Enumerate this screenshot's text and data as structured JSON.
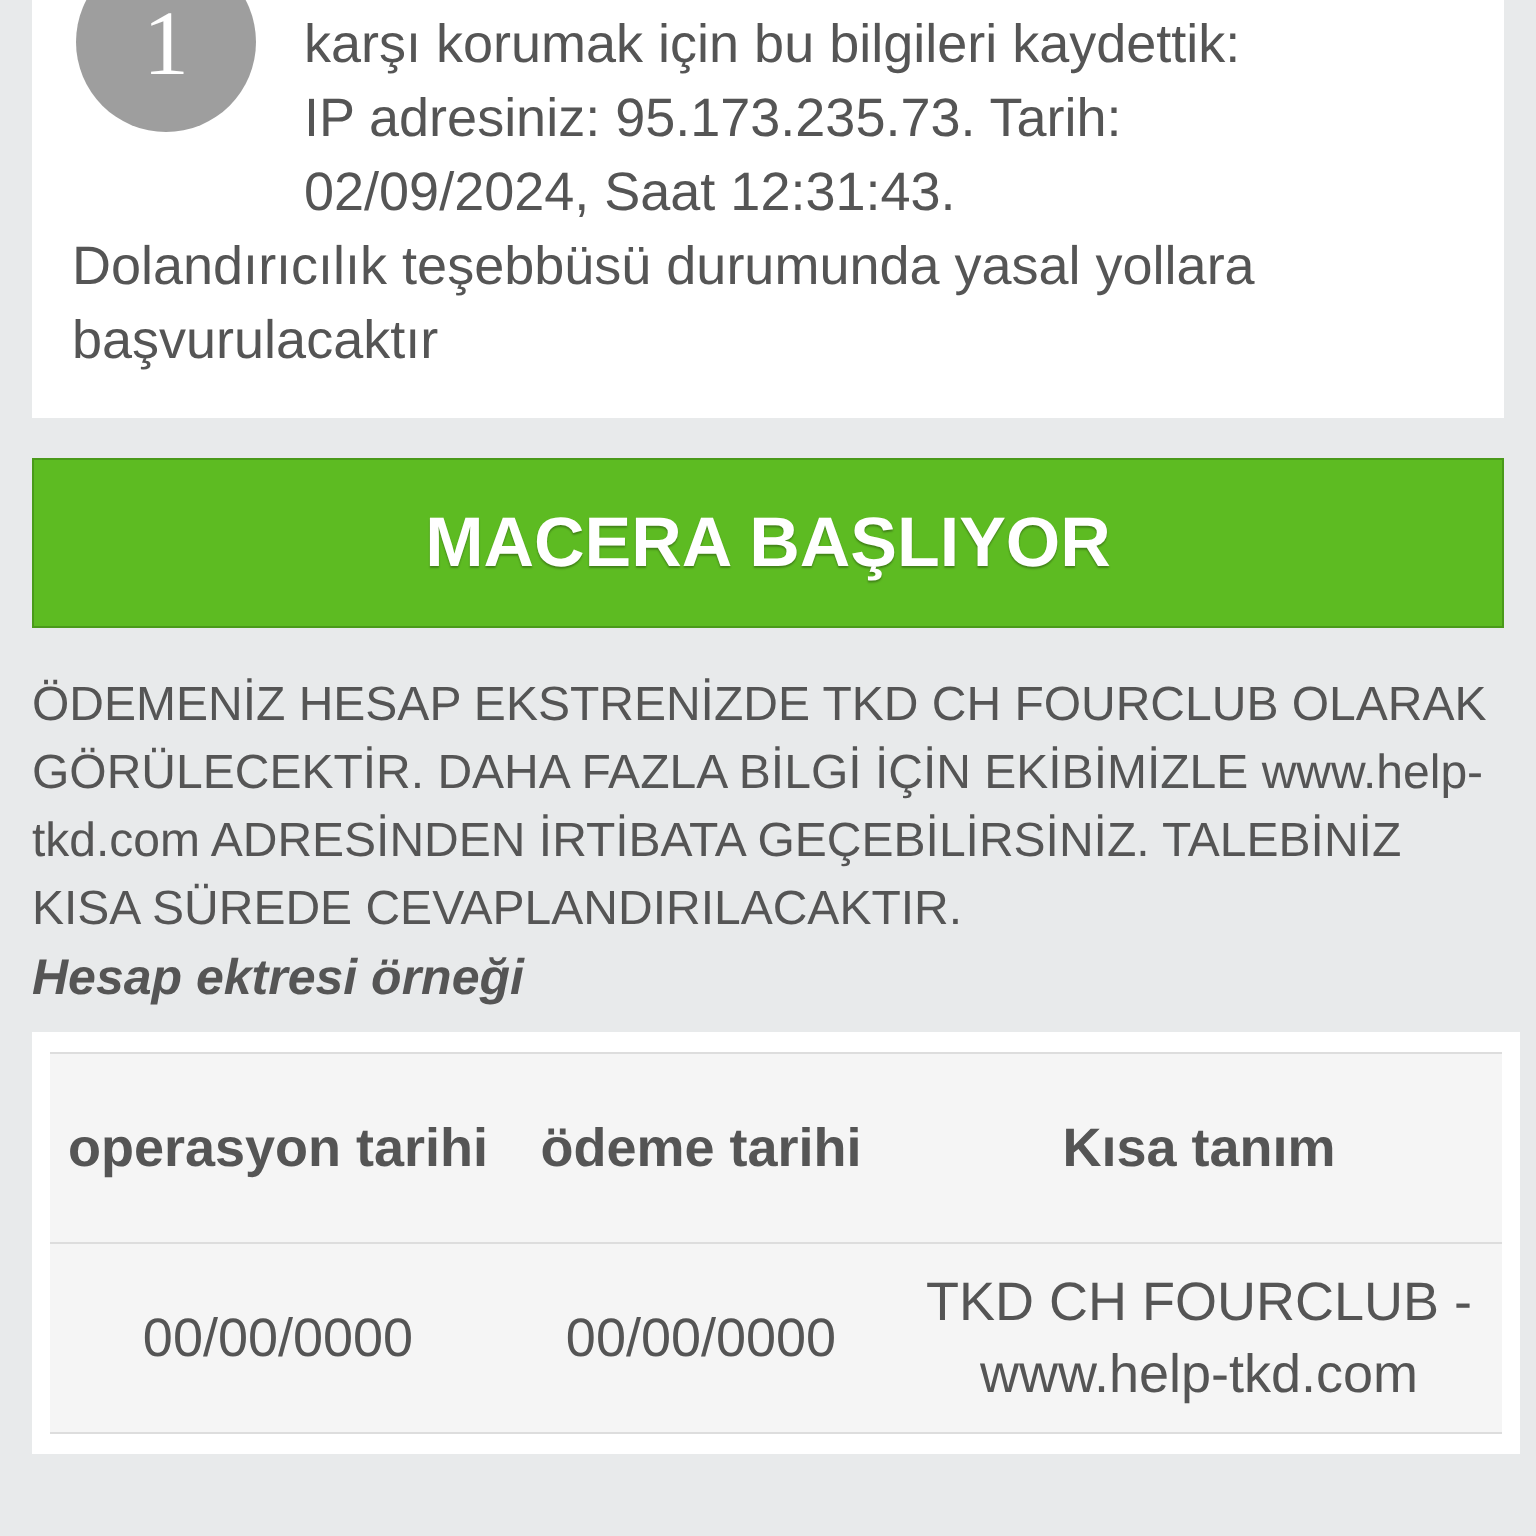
{
  "notice": {
    "step_number": "1",
    "lines": [
      "karşı korumak için bu bilgileri kaydettik:",
      "IP adresiniz: 95.173.235.73. Tarih:",
      "02/09/2024, Saat 12:31:43."
    ],
    "warning": "Dolandırıcılık teşebbüsü durumunda yasal yollara başvurulacaktır"
  },
  "start_button": "MACERA BAŞLIYOR",
  "info": "ÖDEMENİZ HESAP EKSTRENİZDE TKD CH FOURCLUB OLARAK GÖRÜLECEKTİR. DAHA FAZLA BİLGİ İÇİN EKİBİMİZLE www.help-tkd.com ADRESİNDEN İRTİBATA GEÇEBİLİRSİNİZ. TALEBİNİZ KISA SÜREDE CEVAPLANDIRILACAKTIR.",
  "example_title": "Hesap ektresi örneği",
  "table": {
    "columns": [
      "operasyon tarihi",
      "ödeme tarihi",
      "Kısa tanım"
    ],
    "rows": [
      [
        "00/00/0000",
        "00/00/0000",
        "TKD CH FOURCLUB - www.help-tkd.com"
      ]
    ]
  }
}
